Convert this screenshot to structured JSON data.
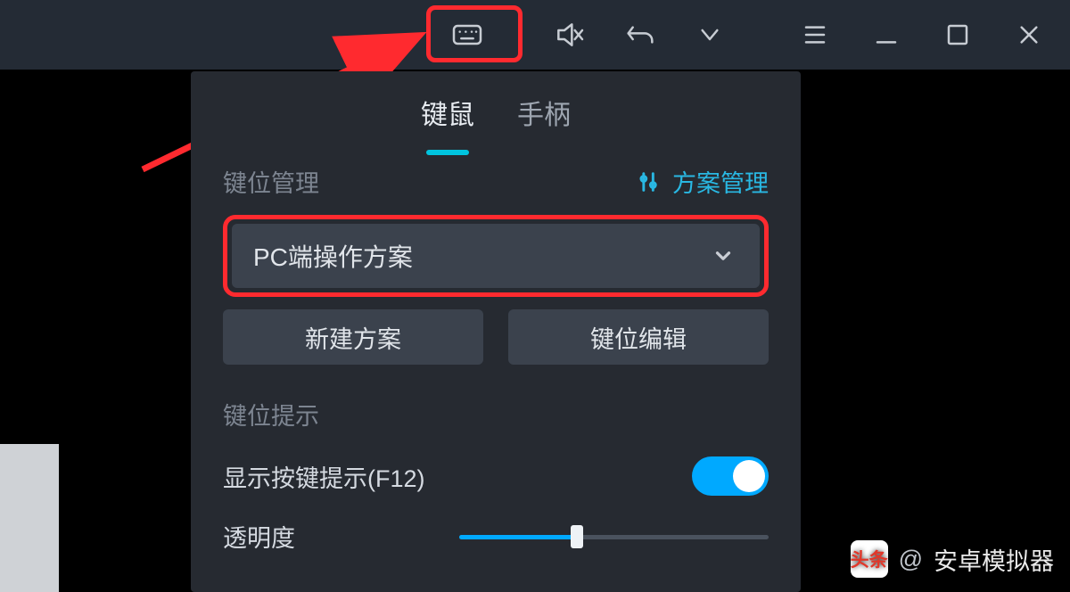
{
  "toolbar": {
    "icons": {
      "keyboard": "keyboard-icon",
      "mute": "speaker-mute-icon",
      "undo": "undo-icon",
      "dropdown": "chevron-down-icon",
      "menu": "hamburger-icon",
      "minimize": "minimize-icon",
      "maximize": "maximize-icon",
      "close": "close-icon"
    }
  },
  "panel": {
    "tabs": {
      "kbmouse": "键鼠",
      "gamepad": "手柄",
      "active": "kbmouse"
    },
    "keymap_section_label": "键位管理",
    "scheme_manage_link": "方案管理",
    "dropdown_selected": "PC端操作方案",
    "btn_new_scheme": "新建方案",
    "btn_edit_keymap": "键位编辑",
    "hint_section_label": "键位提示",
    "toggle_show_hint_label": "显示按键提示(F12)",
    "toggle_show_hint_on": true,
    "opacity_label": "透明度",
    "opacity_value_pct": 38
  },
  "watermark": {
    "badge": "头条",
    "at": "@",
    "name": "安卓模拟器"
  }
}
